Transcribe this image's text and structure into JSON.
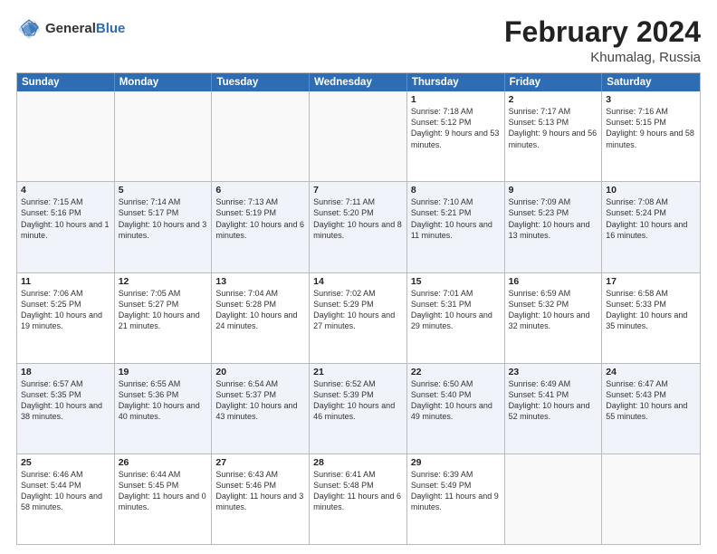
{
  "header": {
    "logo_general": "General",
    "logo_blue": "Blue",
    "title": "February 2024",
    "subtitle": "Khumalag, Russia"
  },
  "days_of_week": [
    "Sunday",
    "Monday",
    "Tuesday",
    "Wednesday",
    "Thursday",
    "Friday",
    "Saturday"
  ],
  "weeks": [
    [
      {
        "day": "",
        "sunrise": "",
        "sunset": "",
        "daylight": ""
      },
      {
        "day": "",
        "sunrise": "",
        "sunset": "",
        "daylight": ""
      },
      {
        "day": "",
        "sunrise": "",
        "sunset": "",
        "daylight": ""
      },
      {
        "day": "",
        "sunrise": "",
        "sunset": "",
        "daylight": ""
      },
      {
        "day": "1",
        "sunrise": "Sunrise: 7:18 AM",
        "sunset": "Sunset: 5:12 PM",
        "daylight": "Daylight: 9 hours and 53 minutes."
      },
      {
        "day": "2",
        "sunrise": "Sunrise: 7:17 AM",
        "sunset": "Sunset: 5:13 PM",
        "daylight": "Daylight: 9 hours and 56 minutes."
      },
      {
        "day": "3",
        "sunrise": "Sunrise: 7:16 AM",
        "sunset": "Sunset: 5:15 PM",
        "daylight": "Daylight: 9 hours and 58 minutes."
      }
    ],
    [
      {
        "day": "4",
        "sunrise": "Sunrise: 7:15 AM",
        "sunset": "Sunset: 5:16 PM",
        "daylight": "Daylight: 10 hours and 1 minute."
      },
      {
        "day": "5",
        "sunrise": "Sunrise: 7:14 AM",
        "sunset": "Sunset: 5:17 PM",
        "daylight": "Daylight: 10 hours and 3 minutes."
      },
      {
        "day": "6",
        "sunrise": "Sunrise: 7:13 AM",
        "sunset": "Sunset: 5:19 PM",
        "daylight": "Daylight: 10 hours and 6 minutes."
      },
      {
        "day": "7",
        "sunrise": "Sunrise: 7:11 AM",
        "sunset": "Sunset: 5:20 PM",
        "daylight": "Daylight: 10 hours and 8 minutes."
      },
      {
        "day": "8",
        "sunrise": "Sunrise: 7:10 AM",
        "sunset": "Sunset: 5:21 PM",
        "daylight": "Daylight: 10 hours and 11 minutes."
      },
      {
        "day": "9",
        "sunrise": "Sunrise: 7:09 AM",
        "sunset": "Sunset: 5:23 PM",
        "daylight": "Daylight: 10 hours and 13 minutes."
      },
      {
        "day": "10",
        "sunrise": "Sunrise: 7:08 AM",
        "sunset": "Sunset: 5:24 PM",
        "daylight": "Daylight: 10 hours and 16 minutes."
      }
    ],
    [
      {
        "day": "11",
        "sunrise": "Sunrise: 7:06 AM",
        "sunset": "Sunset: 5:25 PM",
        "daylight": "Daylight: 10 hours and 19 minutes."
      },
      {
        "day": "12",
        "sunrise": "Sunrise: 7:05 AM",
        "sunset": "Sunset: 5:27 PM",
        "daylight": "Daylight: 10 hours and 21 minutes."
      },
      {
        "day": "13",
        "sunrise": "Sunrise: 7:04 AM",
        "sunset": "Sunset: 5:28 PM",
        "daylight": "Daylight: 10 hours and 24 minutes."
      },
      {
        "day": "14",
        "sunrise": "Sunrise: 7:02 AM",
        "sunset": "Sunset: 5:29 PM",
        "daylight": "Daylight: 10 hours and 27 minutes."
      },
      {
        "day": "15",
        "sunrise": "Sunrise: 7:01 AM",
        "sunset": "Sunset: 5:31 PM",
        "daylight": "Daylight: 10 hours and 29 minutes."
      },
      {
        "day": "16",
        "sunrise": "Sunrise: 6:59 AM",
        "sunset": "Sunset: 5:32 PM",
        "daylight": "Daylight: 10 hours and 32 minutes."
      },
      {
        "day": "17",
        "sunrise": "Sunrise: 6:58 AM",
        "sunset": "Sunset: 5:33 PM",
        "daylight": "Daylight: 10 hours and 35 minutes."
      }
    ],
    [
      {
        "day": "18",
        "sunrise": "Sunrise: 6:57 AM",
        "sunset": "Sunset: 5:35 PM",
        "daylight": "Daylight: 10 hours and 38 minutes."
      },
      {
        "day": "19",
        "sunrise": "Sunrise: 6:55 AM",
        "sunset": "Sunset: 5:36 PM",
        "daylight": "Daylight: 10 hours and 40 minutes."
      },
      {
        "day": "20",
        "sunrise": "Sunrise: 6:54 AM",
        "sunset": "Sunset: 5:37 PM",
        "daylight": "Daylight: 10 hours and 43 minutes."
      },
      {
        "day": "21",
        "sunrise": "Sunrise: 6:52 AM",
        "sunset": "Sunset: 5:39 PM",
        "daylight": "Daylight: 10 hours and 46 minutes."
      },
      {
        "day": "22",
        "sunrise": "Sunrise: 6:50 AM",
        "sunset": "Sunset: 5:40 PM",
        "daylight": "Daylight: 10 hours and 49 minutes."
      },
      {
        "day": "23",
        "sunrise": "Sunrise: 6:49 AM",
        "sunset": "Sunset: 5:41 PM",
        "daylight": "Daylight: 10 hours and 52 minutes."
      },
      {
        "day": "24",
        "sunrise": "Sunrise: 6:47 AM",
        "sunset": "Sunset: 5:43 PM",
        "daylight": "Daylight: 10 hours and 55 minutes."
      }
    ],
    [
      {
        "day": "25",
        "sunrise": "Sunrise: 6:46 AM",
        "sunset": "Sunset: 5:44 PM",
        "daylight": "Daylight: 10 hours and 58 minutes."
      },
      {
        "day": "26",
        "sunrise": "Sunrise: 6:44 AM",
        "sunset": "Sunset: 5:45 PM",
        "daylight": "Daylight: 11 hours and 0 minutes."
      },
      {
        "day": "27",
        "sunrise": "Sunrise: 6:43 AM",
        "sunset": "Sunset: 5:46 PM",
        "daylight": "Daylight: 11 hours and 3 minutes."
      },
      {
        "day": "28",
        "sunrise": "Sunrise: 6:41 AM",
        "sunset": "Sunset: 5:48 PM",
        "daylight": "Daylight: 11 hours and 6 minutes."
      },
      {
        "day": "29",
        "sunrise": "Sunrise: 6:39 AM",
        "sunset": "Sunset: 5:49 PM",
        "daylight": "Daylight: 11 hours and 9 minutes."
      },
      {
        "day": "",
        "sunrise": "",
        "sunset": "",
        "daylight": ""
      },
      {
        "day": "",
        "sunrise": "",
        "sunset": "",
        "daylight": ""
      }
    ]
  ]
}
